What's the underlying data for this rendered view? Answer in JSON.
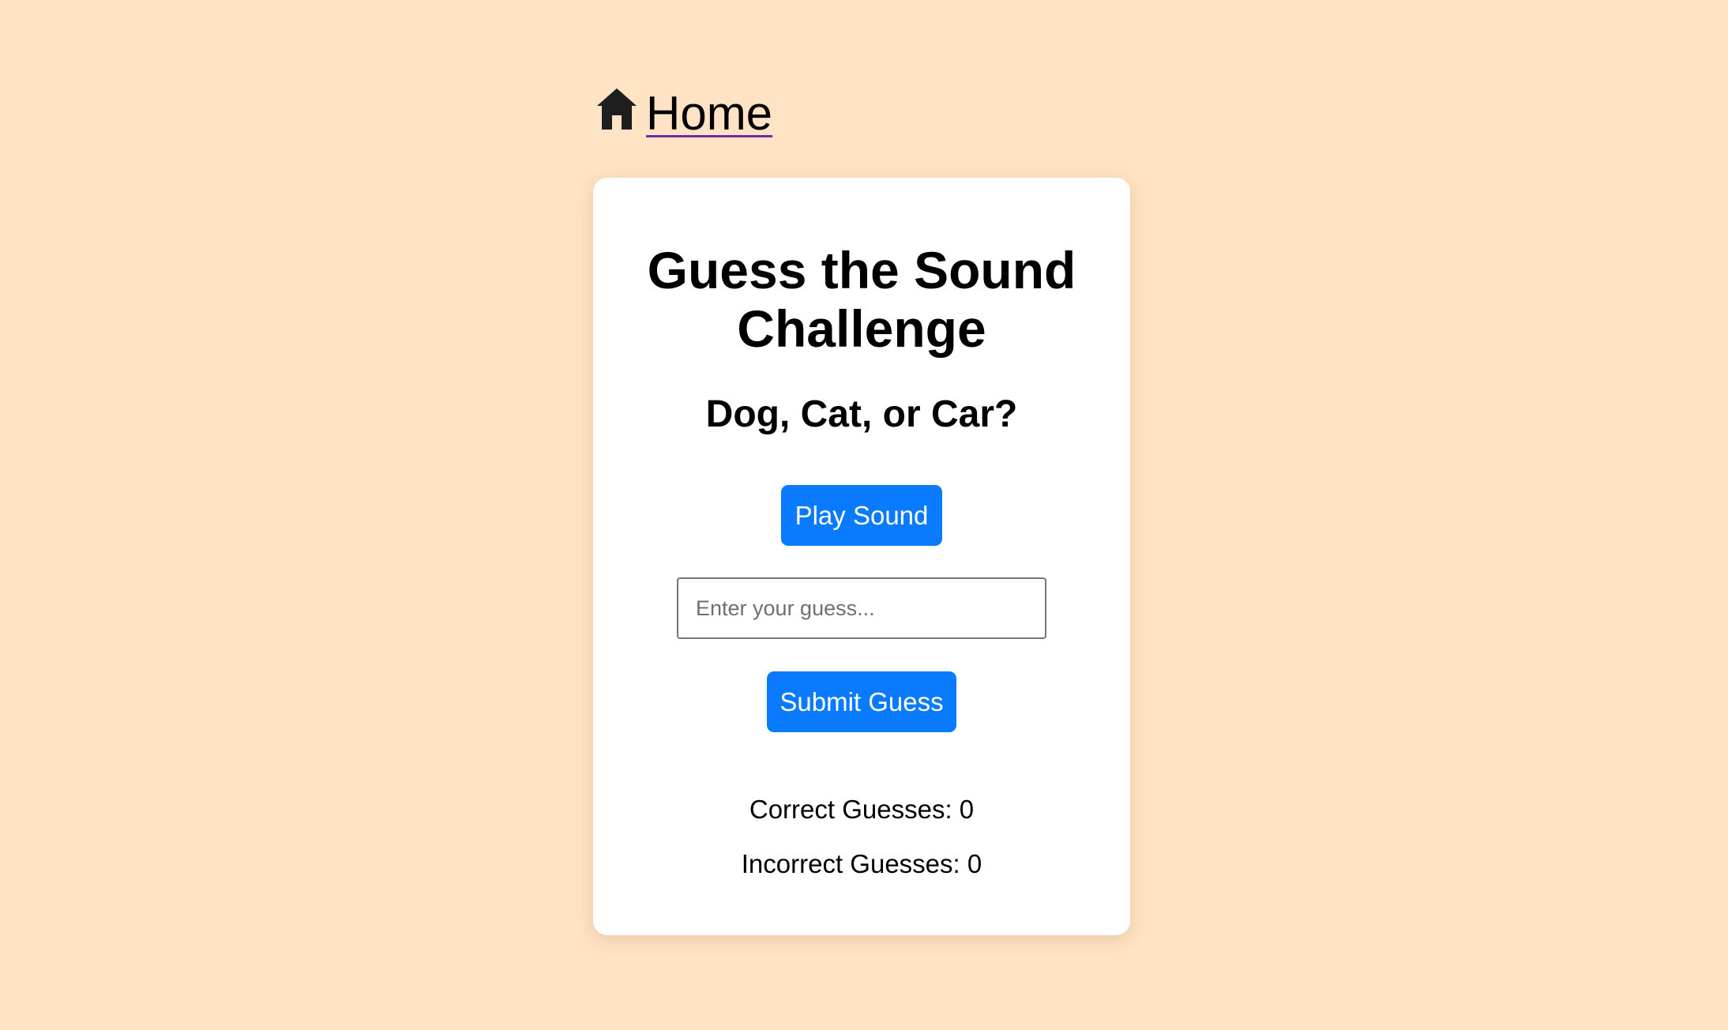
{
  "nav": {
    "home_label": "Home",
    "home_icon": "home-icon"
  },
  "game": {
    "title": "Guess the Sound Challenge",
    "subtitle": "Dog, Cat, or Car?",
    "play_label": "Play Sound",
    "guess_placeholder": "Enter your guess...",
    "guess_value": "",
    "submit_label": "Submit Guess",
    "correct_label": "Correct Guesses: 0",
    "incorrect_label": "Incorrect Guesses: 0"
  },
  "colors": {
    "background": "#ffe3c4",
    "card": "#ffffff",
    "button": "#0a7bff",
    "link_underline": "#6b2fa0"
  }
}
